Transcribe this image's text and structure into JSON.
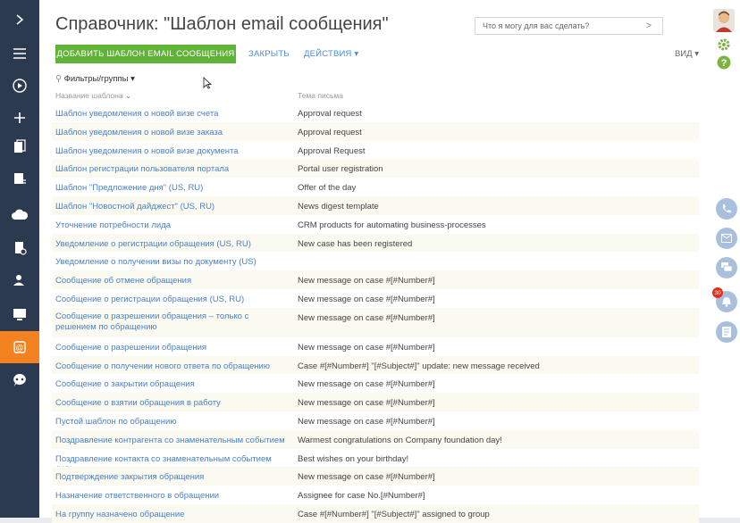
{
  "app": {
    "title": "Справочник: \"Шаблон email сообщения\"",
    "help_placeholder": "Что я могу для вас сделать?"
  },
  "toolbar": {
    "add_label": "ДОБАВИТЬ ШАБЛОН EMAIL СООБЩЕНИЯ",
    "close_label": "ЗАКРЫТЬ",
    "actions_label": "ДЕЙСТВИЯ",
    "view_label": "ВИД"
  },
  "filters_label": "Фильтры/группы",
  "columns": {
    "name": "Название шаблона",
    "subject": "Тема письма"
  },
  "rows": [
    {
      "name": "Шаблон уведомления о новой визе счета",
      "subject": "Approval request"
    },
    {
      "name": "Шаблон уведомления о новой визе заказа",
      "subject": "Approval request"
    },
    {
      "name": "Шаблон уведомления о новой визе документа",
      "subject": "Approval Request"
    },
    {
      "name": "Шаблон регистрации пользователя портала",
      "subject": "Portal user registration"
    },
    {
      "name": "Шаблон \"Предложение дня\" (US, RU)",
      "subject": "Offer of the day"
    },
    {
      "name": "Шаблон \"Новостной дайджест\" (US, RU)",
      "subject": "News digest template"
    },
    {
      "name": "Уточнение потребности лида",
      "subject": "CRM products for automating business-processes"
    },
    {
      "name": "Уведомление о регистрации обращения (US, RU)",
      "subject": "New case has been registered"
    },
    {
      "name": "Уведомление о получении визы по документу (US)",
      "subject": ""
    },
    {
      "name": "Сообщение об отмене обращения",
      "subject": "New message on case #[#Number#]"
    },
    {
      "name": "Сообщение о регистрации обращения (US, RU)",
      "subject": "New message on case #[#Number#]"
    },
    {
      "name": "Сообщение о разрешении обращения – только с решением по обращению",
      "subject": "New message on case #[#Number#]"
    },
    {
      "name": "Сообщение о разрешении обращения",
      "subject": "New message on case #[#Number#]"
    },
    {
      "name": "Сообщение о получении нового ответа по обращению",
      "subject": "Case #[#Number#] \"[#Subject#]\" update: new message received"
    },
    {
      "name": "Сообщение о закрытии обращения",
      "subject": "New message on case #[#Number#]"
    },
    {
      "name": "Сообщение о взятии обращения в работу",
      "subject": "New message on case #[#Number#]"
    },
    {
      "name": "Пустой шаблон по обращению",
      "subject": "New message on case #[#Number#]"
    },
    {
      "name": "Поздравление контрагента со знаменательным событием",
      "subject": "Warmest congratulations on Company foundation day!"
    },
    {
      "name": "Поздравление контакта со знаменательным событием (US)",
      "subject": "Best wishes on your birthday!"
    },
    {
      "name": "Подтверждение закрытия обращения",
      "subject": "New message on case #[#Number#]"
    },
    {
      "name": "Назначение ответственного в обращении",
      "subject": "Assignee for case No.[#Number#]"
    },
    {
      "name": "На группу назначено обращение",
      "subject": "Case #[#Number#] \"[#Subject#]\" assigned to group"
    }
  ],
  "notifications_count": "30",
  "colors": {
    "sidebar": "#2b3a4e",
    "active_section": "#f58220",
    "primary_button": "#5fb336",
    "link": "#4a7fc9",
    "comm_fab": "#a9c0dc",
    "badge": "#e0311f"
  }
}
